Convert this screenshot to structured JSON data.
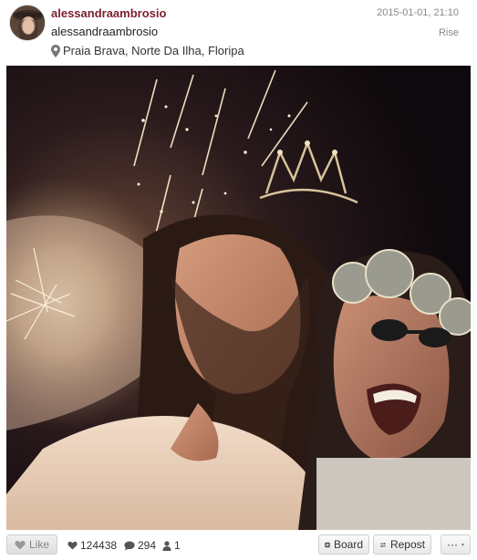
{
  "post": {
    "username": "alessandraambrosio",
    "full_name": "alessandraambrosio",
    "location": "Praia Brava, Norte Da Ilha, Floripa",
    "timestamp": "2015-01-01, 21:10",
    "filter": "Rise"
  },
  "actions": {
    "like_label": "Like",
    "likes_count": "124438",
    "comments_count": "294",
    "reposts_count": "1",
    "board_label": "Board",
    "repost_label": "Repost",
    "more_label": "···"
  },
  "icons": {
    "location": "map-pin-icon",
    "like": "heart-icon",
    "likes": "heart-icon",
    "comments": "speech-bubble-icon",
    "reposts": "person-icon",
    "board": "plus-square-icon",
    "repost": "repost-arrows-icon",
    "more": "chevron-down-icon"
  },
  "colors": {
    "username": "#7a1f2e",
    "muted": "#888888"
  }
}
